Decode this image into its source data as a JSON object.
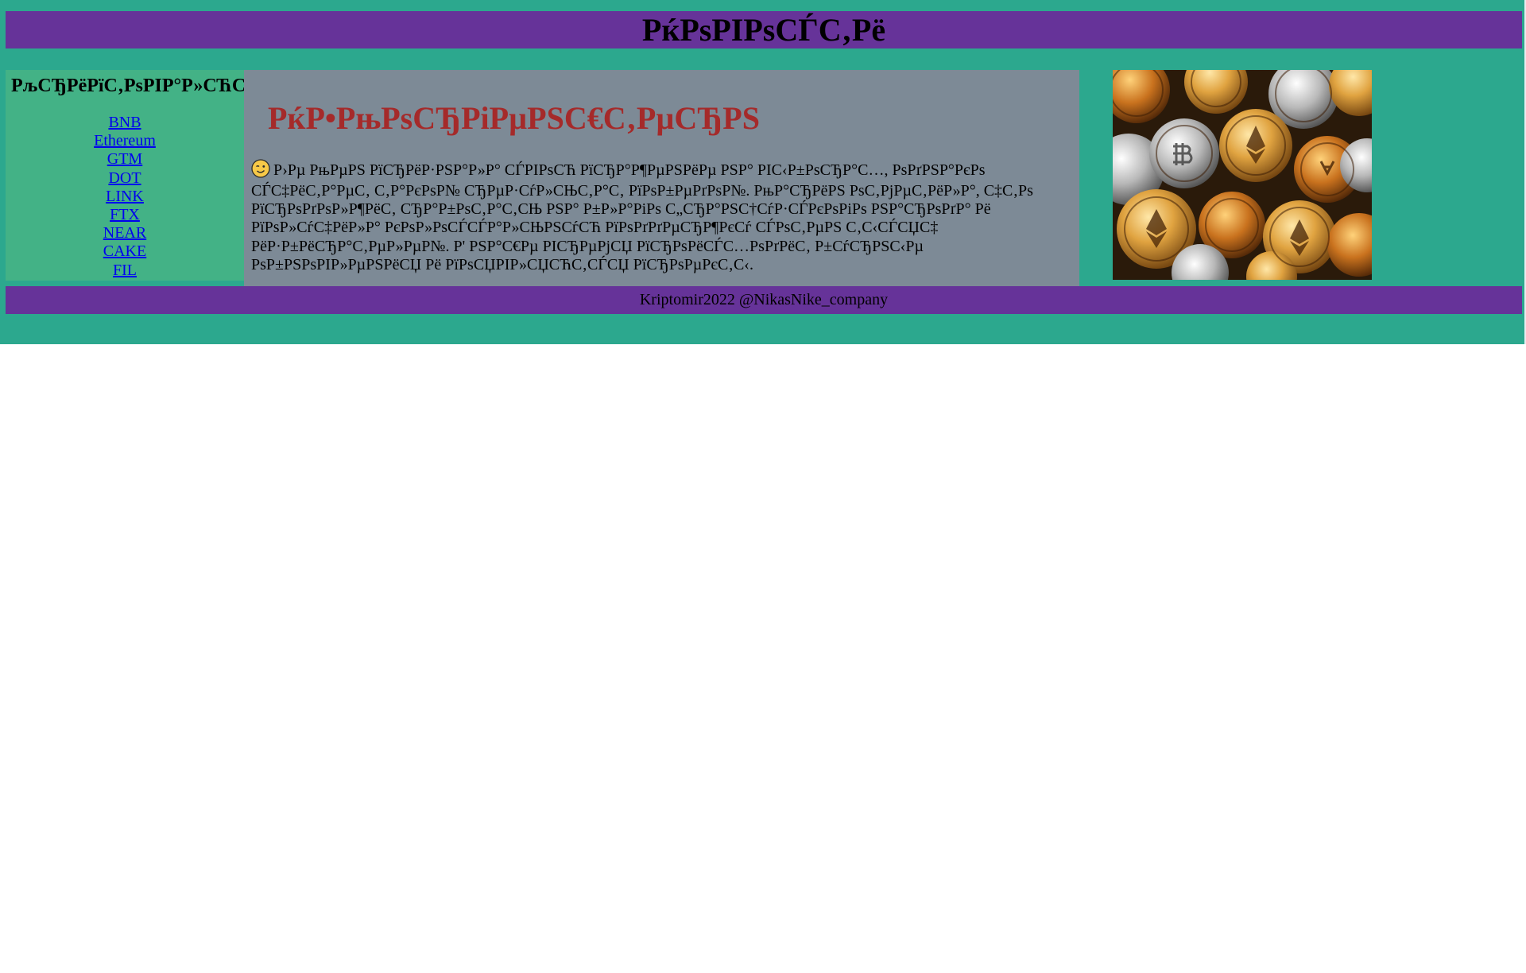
{
  "header": {
    "title": "РќРѕРІРѕСЃС‚Рё"
  },
  "sidebar": {
    "title": "РљСЂРёРїС‚РѕРІР°Р»СЋС‚С‹",
    "links": [
      "BNB",
      "Ethereum",
      "GTM",
      "DOT",
      "LINK",
      "FTX",
      "NEAR",
      "CAKE",
      "FIL"
    ]
  },
  "main": {
    "heading": "РќР•РњРѕСЂРіРµРЅС€С‚РµСЂРЅ",
    "emoji": "wink-emoji-icon",
    "text": "Р›Рµ РњРµРЅ РїСЂРёР·РЅР°Р»Р° СЃРІРѕСЋ РїСЂР°Р¶РµРЅРёРµ РЅР° РІС‹Р±РѕСЂР°С…, РѕРґРЅР°РєРѕ СЃС‡РёС‚Р°РµС‚ С‚Р°РєРѕР№ СЂРµР·СѓР»СЊС‚Р°С‚ РїРѕР±РµРґРѕР№. РњР°СЂРёРЅ РѕС‚РјРµС‚РёР»Р°, С‡С‚Рѕ РїСЂРѕРґРѕР»Р¶РёС‚ СЂР°Р±РѕС‚Р°С‚СЊ РЅР° Р±Р»Р°РіРѕ С„СЂР°РЅС†СѓР·СЃРєРѕРіРѕ РЅР°СЂРѕРґР° Рё РїРѕР»СѓС‡РёР»Р° РєРѕР»РѕСЃСЃР°Р»СЊРЅСѓСЋ РїРѕРґРґРµСЂР¶РєСѓ СЃРѕС‚РµРЅ С‚С‹СЃСЏС‡ РёР·Р±РёСЂР°С‚РµР»РµР№. Р' РЅР°С€Рµ РІСЂРµРјСЏ РїСЂРѕРёСЃС…РѕРґРёС‚ Р±СѓСЂРЅС‹Рµ РѕР±РЅРѕРІР»РµРЅРёСЏ Рё РїРѕСЏРІР»СЏСЋС‚СЃСЏ РїСЂРѕРµРєС‚С‹."
  },
  "image": {
    "subject": "crypto-coins-photo"
  },
  "footer": {
    "text": "Kriptomir2022 @NikasNike_company"
  },
  "colors": {
    "page_bg": "#2ca88e",
    "header_bg": "#663399",
    "sidebar_bg": "#43b286",
    "main_bg": "#7d8a96",
    "heading": "#a52a2a",
    "link": "#0000ee"
  }
}
